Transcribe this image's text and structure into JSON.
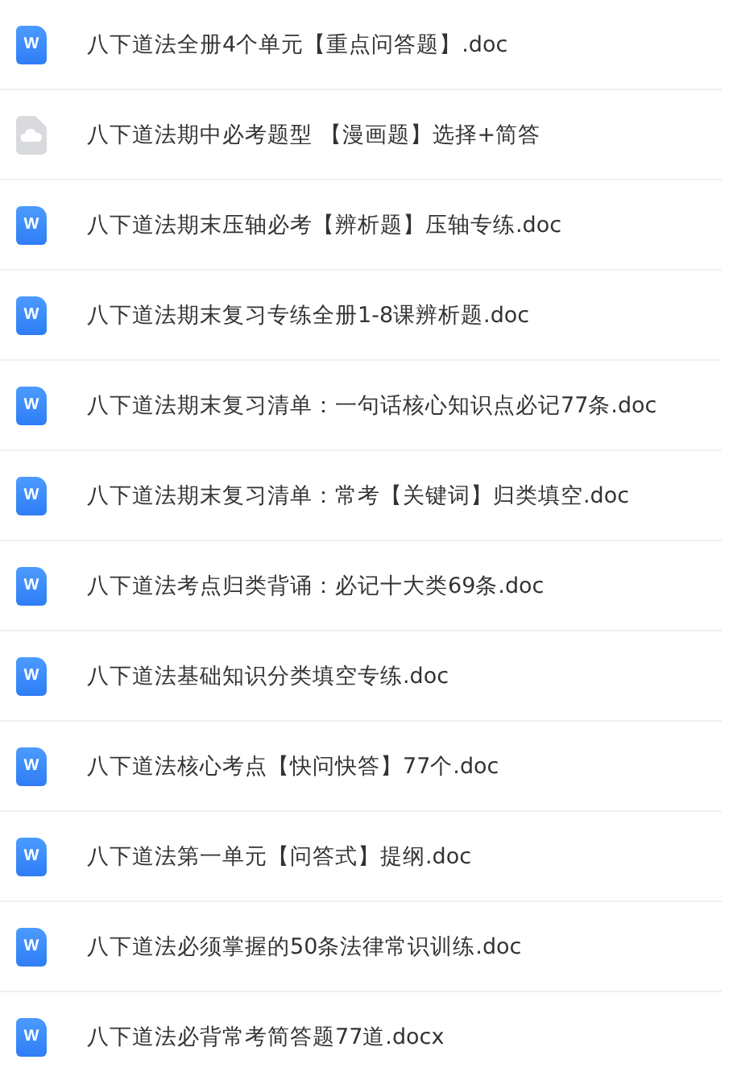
{
  "files": [
    {
      "kind": "doc",
      "badge": "W",
      "name": "八下道法全册4个单元【重点问答题】.doc"
    },
    {
      "kind": "cloud",
      "name": "八下道法期中必考题型 【漫画题】选择+简答"
    },
    {
      "kind": "doc",
      "badge": "W",
      "name": "八下道法期末压轴必考【辨析题】压轴专练.doc"
    },
    {
      "kind": "doc",
      "badge": "W",
      "name": "八下道法期末复习专练全册1-8课辨析题.doc"
    },
    {
      "kind": "doc",
      "badge": "W",
      "name": "八下道法期末复习清单：一句话核心知识点必记77条.doc"
    },
    {
      "kind": "doc",
      "badge": "W",
      "name": "八下道法期末复习清单：常考【关键词】归类填空.doc"
    },
    {
      "kind": "doc",
      "badge": "W",
      "name": "八下道法考点归类背诵：必记十大类69条.doc"
    },
    {
      "kind": "doc",
      "badge": "W",
      "name": "八下道法基础知识分类填空专练.doc"
    },
    {
      "kind": "doc",
      "badge": "W",
      "name": "八下道法核心考点【快问快答】77个.doc"
    },
    {
      "kind": "doc",
      "badge": "W",
      "name": "八下道法第一单元【问答式】提纲.doc"
    },
    {
      "kind": "doc",
      "badge": "W",
      "name": "八下道法必须掌握的50条法律常识训练.doc"
    },
    {
      "kind": "doc",
      "badge": "W",
      "name": "八下道法必背常考简答题77道.docx"
    }
  ]
}
